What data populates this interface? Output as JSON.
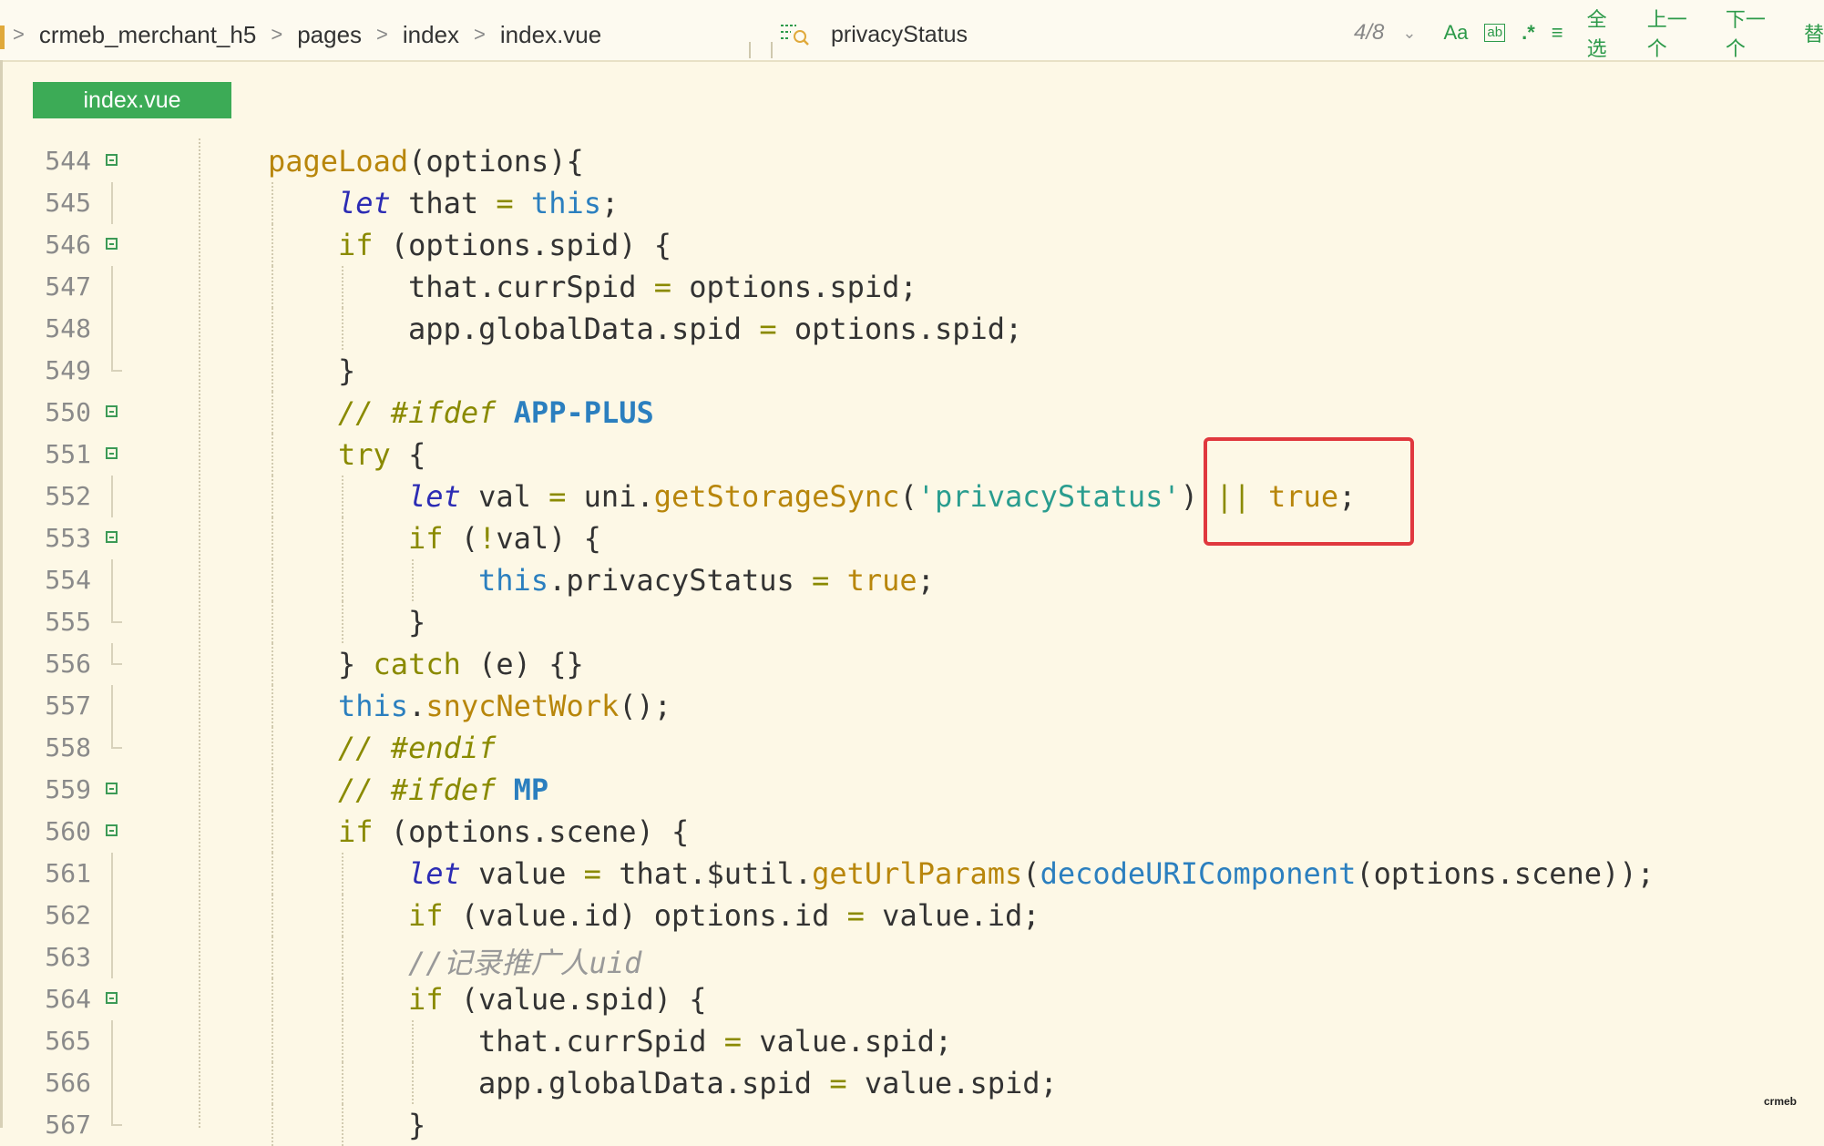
{
  "breadcrumb": [
    "crmeb_merchant_h5",
    "pages",
    "index",
    "index.vue"
  ],
  "search": {
    "query": "privacyStatus",
    "count": "4/8",
    "tools": [
      "Aa",
      "ab",
      ".*",
      "≡"
    ],
    "select_all": "全选",
    "prev": "上一个",
    "next": "下一个",
    "more": "替"
  },
  "tab_label": "index.vue",
  "watermark": "crmeb",
  "colors": {
    "tab": "#3cab56",
    "highlight": "#e0383e",
    "background": "#fdf8e6"
  },
  "lines": [
    {
      "n": "544",
      "fold": "start",
      "indent": 0,
      "tokens": [
        [
          "fn",
          "pageLoad"
        ],
        [
          "",
          "(options){"
        ]
      ]
    },
    {
      "n": "545",
      "fold": "line",
      "indent": 1,
      "tokens": [
        [
          "lt",
          "let"
        ],
        [
          "",
          " that "
        ],
        [
          "op",
          "="
        ],
        [
          "",
          " "
        ],
        [
          "th",
          "this"
        ],
        [
          "",
          ";"
        ]
      ]
    },
    {
      "n": "546",
      "fold": "start",
      "indent": 1,
      "tokens": [
        [
          "kw",
          "if"
        ],
        [
          "",
          " (options.spid) {"
        ]
      ]
    },
    {
      "n": "547",
      "fold": "line",
      "indent": 2,
      "tokens": [
        [
          "",
          "that.currSpid "
        ],
        [
          "op",
          "="
        ],
        [
          "",
          " options.spid;"
        ]
      ]
    },
    {
      "n": "548",
      "fold": "line",
      "indent": 2,
      "tokens": [
        [
          "",
          "app.globalData.spid "
        ],
        [
          "op",
          "="
        ],
        [
          "",
          " options.spid;"
        ]
      ]
    },
    {
      "n": "549",
      "fold": "end",
      "indent": 1,
      "tokens": [
        [
          "",
          "}"
        ]
      ]
    },
    {
      "n": "550",
      "fold": "start",
      "indent": 1,
      "tokens": [
        [
          "cm",
          "// #ifdef "
        ],
        [
          "mac",
          "APP-PLUS"
        ]
      ]
    },
    {
      "n": "551",
      "fold": "start",
      "indent": 1,
      "tokens": [
        [
          "kw",
          "try"
        ],
        [
          "",
          " {"
        ]
      ]
    },
    {
      "n": "552",
      "fold": "line",
      "indent": 2,
      "tokens": [
        [
          "lt",
          "let"
        ],
        [
          "",
          " val "
        ],
        [
          "op",
          "="
        ],
        [
          "",
          " uni."
        ],
        [
          "fn",
          "getStorageSync"
        ],
        [
          "",
          "("
        ],
        [
          "str",
          "'privacyStatus'"
        ],
        [
          "",
          ") "
        ],
        [
          "op",
          "||"
        ],
        [
          "",
          " "
        ],
        [
          "bool",
          "true"
        ],
        [
          "",
          ";"
        ]
      ]
    },
    {
      "n": "553",
      "fold": "start",
      "indent": 2,
      "tokens": [
        [
          "kw",
          "if"
        ],
        [
          "",
          " ("
        ],
        [
          "op",
          "!"
        ],
        [
          "",
          "val) {"
        ]
      ]
    },
    {
      "n": "554",
      "fold": "line",
      "indent": 3,
      "tokens": [
        [
          "th",
          "this"
        ],
        [
          "",
          ".privacyStatus "
        ],
        [
          "op",
          "="
        ],
        [
          "",
          " "
        ],
        [
          "bool",
          "true"
        ],
        [
          "",
          ";"
        ]
      ]
    },
    {
      "n": "555",
      "fold": "end",
      "indent": 2,
      "tokens": [
        [
          "",
          "}"
        ]
      ]
    },
    {
      "n": "556",
      "fold": "end",
      "indent": 1,
      "tokens": [
        [
          "",
          "} "
        ],
        [
          "kw",
          "catch"
        ],
        [
          "",
          " (e) {}"
        ]
      ]
    },
    {
      "n": "557",
      "fold": "line",
      "indent": 1,
      "tokens": [
        [
          "th",
          "this"
        ],
        [
          "",
          "."
        ],
        [
          "fn",
          "snycNetWork"
        ],
        [
          "",
          "();"
        ]
      ]
    },
    {
      "n": "558",
      "fold": "end",
      "indent": 1,
      "tokens": [
        [
          "cm",
          "// #endif"
        ]
      ]
    },
    {
      "n": "559",
      "fold": "start",
      "indent": 1,
      "tokens": [
        [
          "cm",
          "// #ifdef "
        ],
        [
          "mac",
          "MP"
        ]
      ]
    },
    {
      "n": "560",
      "fold": "start",
      "indent": 1,
      "tokens": [
        [
          "kw",
          "if"
        ],
        [
          "",
          " (options.scene) {"
        ]
      ]
    },
    {
      "n": "561",
      "fold": "line",
      "indent": 2,
      "tokens": [
        [
          "lt",
          "let"
        ],
        [
          "",
          " value "
        ],
        [
          "op",
          "="
        ],
        [
          "",
          " that.$util."
        ],
        [
          "fn",
          "getUrlParams"
        ],
        [
          "",
          "("
        ],
        [
          "th",
          "decodeURIComponent"
        ],
        [
          "",
          "(options.scene));"
        ]
      ]
    },
    {
      "n": "562",
      "fold": "line",
      "indent": 2,
      "tokens": [
        [
          "kw",
          "if"
        ],
        [
          "",
          " (value.id) options.id "
        ],
        [
          "op",
          "="
        ],
        [
          "",
          " value.id;"
        ]
      ]
    },
    {
      "n": "563",
      "fold": "line",
      "indent": 2,
      "tokens": [
        [
          "cmc",
          "//记录推广人uid"
        ]
      ]
    },
    {
      "n": "564",
      "fold": "start",
      "indent": 2,
      "tokens": [
        [
          "kw",
          "if"
        ],
        [
          "",
          " (value.spid) {"
        ]
      ]
    },
    {
      "n": "565",
      "fold": "line",
      "indent": 3,
      "tokens": [
        [
          "",
          "that.currSpid "
        ],
        [
          "op",
          "="
        ],
        [
          "",
          " value.spid;"
        ]
      ]
    },
    {
      "n": "566",
      "fold": "line",
      "indent": 3,
      "tokens": [
        [
          "",
          "app.globalData.spid "
        ],
        [
          "op",
          "="
        ],
        [
          "",
          " value.spid;"
        ]
      ]
    },
    {
      "n": "567",
      "fold": "end",
      "indent": 2,
      "tokens": [
        [
          "",
          "}"
        ]
      ]
    }
  ]
}
